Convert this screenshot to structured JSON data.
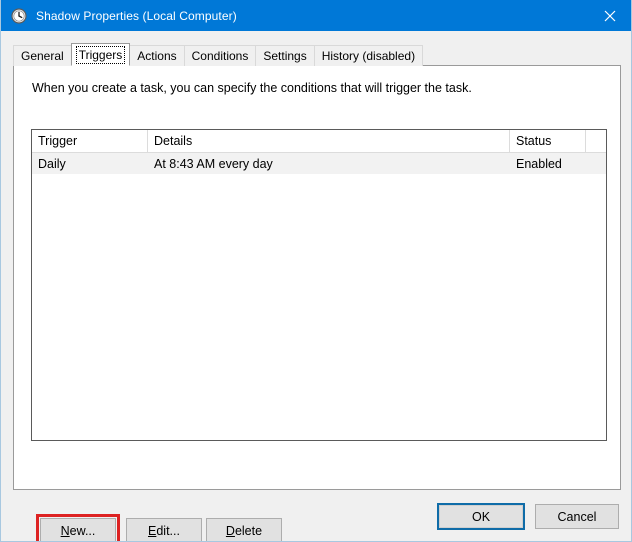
{
  "window": {
    "title": "Shadow Properties (Local Computer)",
    "icon": "clock-icon",
    "close_label": "✕",
    "accent_color": "#0078d7",
    "background_color": "#f0f0f0"
  },
  "tabs": [
    {
      "label": "General",
      "selected": false
    },
    {
      "label": "Triggers",
      "selected": true
    },
    {
      "label": "Actions",
      "selected": false
    },
    {
      "label": "Conditions",
      "selected": false
    },
    {
      "label": "Settings",
      "selected": false
    },
    {
      "label": "History (disabled)",
      "selected": false
    }
  ],
  "panel": {
    "description": "When you create a task, you can specify the conditions that will trigger the task."
  },
  "triggers_list": {
    "columns": [
      "Trigger",
      "Details",
      "Status"
    ],
    "rows": [
      {
        "trigger": "Daily",
        "details": "At 8:43 AM every day",
        "status": "Enabled"
      }
    ]
  },
  "action_buttons": {
    "new": {
      "accel": "N",
      "rest": "ew...",
      "highlighted": true,
      "highlight_color": "#dd2222"
    },
    "edit": {
      "accel": "E",
      "rest": "dit...",
      "highlighted": false
    },
    "delete": {
      "accel": "D",
      "rest": "elete",
      "highlighted": false
    }
  },
  "footer": {
    "ok_label": "OK",
    "cancel_label": "Cancel",
    "default_button": "OK",
    "focus_color": "#0f6ca8"
  }
}
